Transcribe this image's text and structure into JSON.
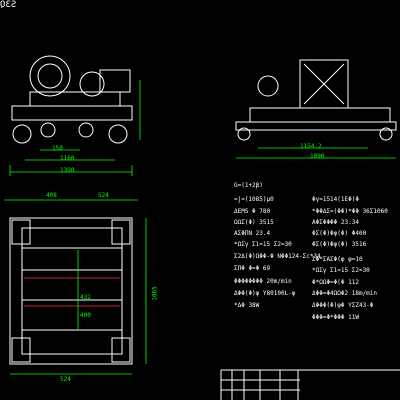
{
  "corner_label": "S3Q",
  "left_view": {
    "dims": [
      "150",
      "1160",
      "1390"
    ]
  },
  "right_view": {
    "dims": [
      "1154.2",
      "1090"
    ]
  },
  "plan_view": {
    "dims_top": [
      "408",
      "524"
    ],
    "dims_side": [
      "1065",
      "432",
      "400"
    ],
    "dims_bottom": [
      "524"
    ]
  },
  "specs_left": [
    "G=(1+2β)",
    "=j=(1085)μ0",
    "ΔEMS        Φ 780",
    "ΩΩΣ(Φ)      3515",
    "ΑΣΦΠΝ       23.4",
    "*ΩΣγ       Σ1=15  Σ2=30",
    "Σ2Δ(Φ)ΩΦΦ-Φ  NΦΦ124-Σc*34",
    "ΣΠΦ   Φ=Φ     69",
    "ΦΦΦΦΦΦΦΦ    20m/min",
    "ΔΦΦ(Φ)φ    Y80100L-φ",
    "*ΔΦ        38W"
  ],
  "specs_right": [
    "Φγ=1514(1ΕΦ(Φ",
    "*ΦΦΔΣ=(ΦΦ)*ΦΦ    36Σ1060",
    "ΑΦΣΦΦΦΦ         23.34",
    "ΦΣ(Φ)Φφ(Φ)      Φ400",
    "ΦΣ(Φ)Φφ(Φ)      3516",
    "ΣΦ*ΣΑΣΦ(φ        φ=10",
    "*ΩΣγ       Σ1=15  Σ2=30",
    "Φ*ΩΩΦ=Φ(Φ        112",
    "ΔΦΦ=Φ4ΩΩΦ2      18m/min",
    "ΔΦΦΦ(Φ)φΦ    YΣΖ43-Φ",
    "ΦΦΦ=Φ*ΦΦΦ      11W"
  ],
  "colors": {
    "background": "#000000",
    "line": "#ffffff",
    "dimension": "#00ff00",
    "accent": "#ff3030"
  }
}
